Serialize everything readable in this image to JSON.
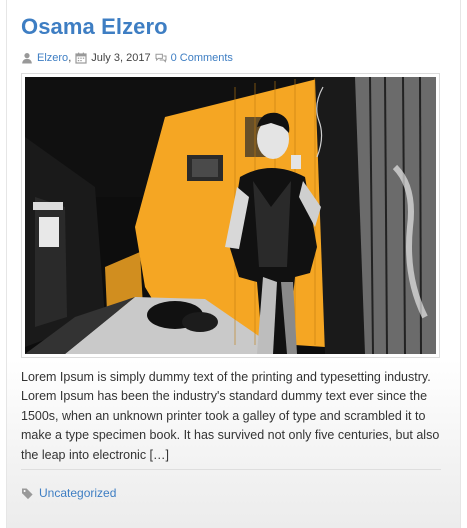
{
  "post": {
    "title": "Osama Elzero",
    "author": "Elzero",
    "author_sep": ",",
    "date": "July 3, 2017",
    "comments": "0 Comments",
    "excerpt": "Lorem Ipsum is simply dummy text of the printing and typesetting industry. Lorem Ipsum has been the industry's standard dummy text ever since the 1500s, when an unknown printer took a galley of type and scrambled it to make a type specimen book. It has survived not only five centuries, but also the leap into electronic […]",
    "category": "Uncategorized"
  },
  "icons": {
    "author": "user-icon",
    "date": "calendar-icon",
    "comments": "comments-icon",
    "category": "tags-icon"
  },
  "colors": {
    "link": "#3e7ec3",
    "meta_icon": "#999999",
    "image_yellow": "#f5a623",
    "image_dark": "#111111"
  }
}
